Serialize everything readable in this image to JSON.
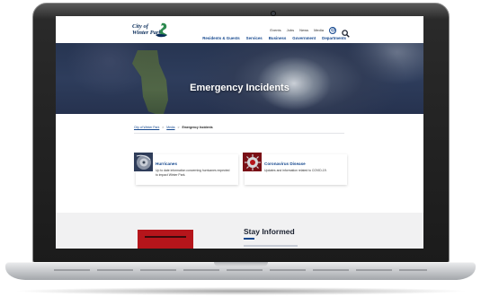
{
  "header": {
    "logo_line1": "City of",
    "logo_line2": "Winter Park",
    "utility_links": [
      "Events",
      "Jobs",
      "News",
      "Media"
    ],
    "main_nav": [
      "Residents & Guests",
      "Services",
      "Business",
      "Government",
      "Departments"
    ]
  },
  "hero": {
    "title": "Emergency Incidents"
  },
  "breadcrumb": {
    "home": "City of Winter Park",
    "parent": "Media",
    "separator": ">",
    "current": "Emergency Incidents"
  },
  "cards": [
    {
      "title": "Hurricanes",
      "description": "Up to date information concerning hurricanes expected to impact Winter Park."
    },
    {
      "title": "Coronavirus Disease",
      "description": "Updates and information related to COVID-19."
    }
  ],
  "lower": {
    "heading": "Stay Informed"
  },
  "colors": {
    "brand_blue": "#14478e",
    "navy": "#0a2d5a",
    "logo_green": "#2d8a4f",
    "covid_red": "#b5151b"
  }
}
